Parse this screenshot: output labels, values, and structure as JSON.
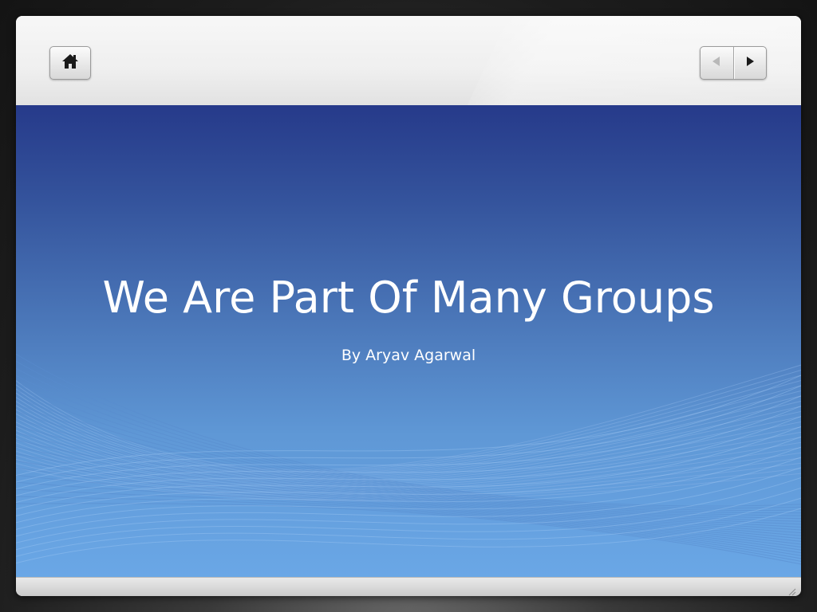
{
  "toolbar": {
    "home_icon": "home-icon",
    "prev_icon": "previous-arrow-icon",
    "next_icon": "next-arrow-icon"
  },
  "slide": {
    "title": "We Are Part Of Many Groups",
    "subtitle": "By Aryav Agarwal"
  },
  "colors": {
    "slide_top": "#263a8a",
    "slide_bottom": "#6aa7e6",
    "text": "#ffffff",
    "frame": "#eeeeee"
  }
}
